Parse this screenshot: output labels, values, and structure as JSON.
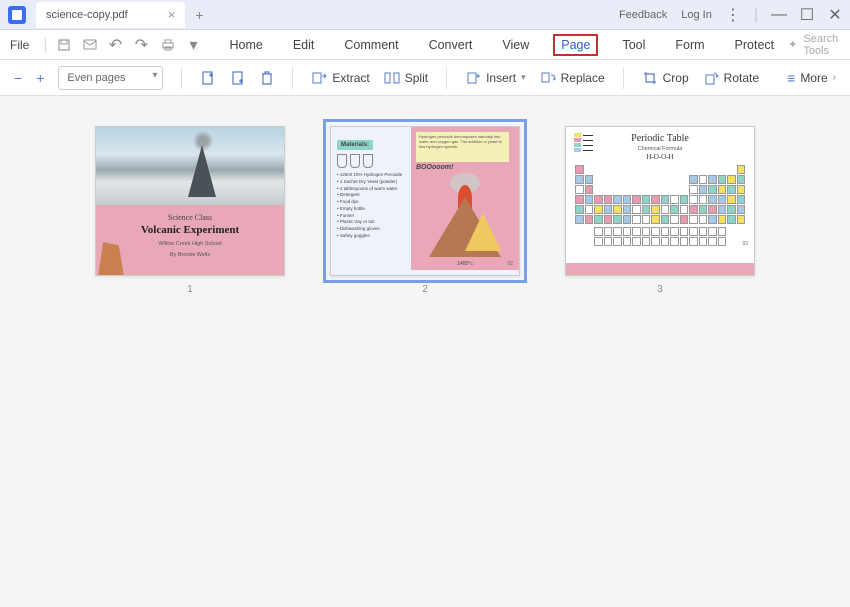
{
  "titlebar": {
    "tab_name": "science-copy.pdf",
    "feedback": "Feedback",
    "login": "Log In"
  },
  "menubar": {
    "file": "File",
    "items": [
      "Home",
      "Edit",
      "Comment",
      "Convert",
      "View",
      "Page",
      "Tool",
      "Form",
      "Protect"
    ],
    "active_index": 5,
    "search_placeholder": "Search Tools"
  },
  "toolbar": {
    "page_filter": "Even pages",
    "extract": "Extract",
    "split": "Split",
    "insert": "Insert",
    "replace": "Replace",
    "crop": "Crop",
    "rotate": "Rotate",
    "more": "More"
  },
  "thumbnails": {
    "selected": 2,
    "pages": [
      {
        "num": "1",
        "title_small": "Science Class",
        "title_big": "Volcanic Experiment",
        "subtitle1": "Willow Creek High School",
        "subtitle2": "By Brooke Wells"
      },
      {
        "num": "2",
        "materials_label": "Materials:",
        "boom": "BOOooom!",
        "list": [
          "125ml 10% Hydrogen Peroxide",
          "1 Sachet Dry Yeast (powder)",
          "4 tablespoons of warm water",
          "Detergent",
          "Food dye",
          "Empty bottle",
          "Funnel",
          "Plastic tray or tub",
          "Dishwashing gloves",
          "Safety goggles"
        ],
        "temp": "1400°c",
        "pagenum": "02",
        "note_text": "Hydrogen peroxide decomposes naturally into water and oxygen gas. The addition of yeast to this hydrogen speeds."
      },
      {
        "num": "3",
        "title": "Periodic Table",
        "subtitle": "Chemical Formula",
        "formula": "H-O-O-H",
        "pagenum": "03"
      }
    ]
  }
}
